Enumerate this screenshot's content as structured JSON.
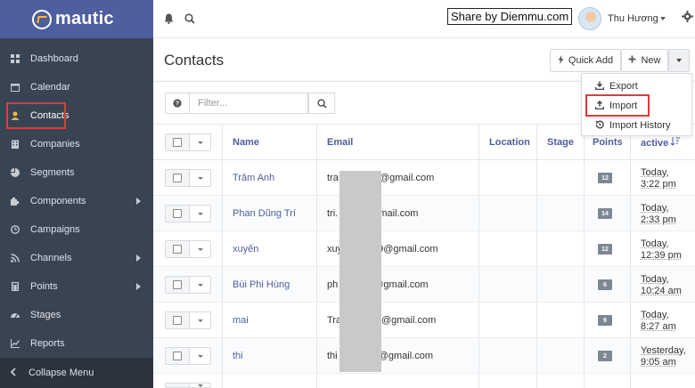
{
  "app": {
    "brand": "mautic"
  },
  "sidebar": {
    "items": [
      {
        "label": "Dashboard",
        "icon": "dashboard-icon"
      },
      {
        "label": "Calendar",
        "icon": "calendar-icon"
      },
      {
        "label": "Contacts",
        "icon": "user-icon"
      },
      {
        "label": "Companies",
        "icon": "building-icon"
      },
      {
        "label": "Segments",
        "icon": "pie-chart-icon"
      },
      {
        "label": "Components",
        "icon": "puzzle-icon"
      },
      {
        "label": "Campaigns",
        "icon": "clock-icon"
      },
      {
        "label": "Channels",
        "icon": "rss-icon"
      },
      {
        "label": "Points",
        "icon": "calculator-icon"
      },
      {
        "label": "Stages",
        "icon": "tachometer-icon"
      },
      {
        "label": "Reports",
        "icon": "line-chart-icon"
      }
    ],
    "collapse_label": "Collapse Menu"
  },
  "topbar": {
    "watermark": "Share by Diemmu.com",
    "user_name": "Thu Hương"
  },
  "page": {
    "title": "Contacts",
    "quick_add": "Quick Add",
    "new": "New"
  },
  "dropdown": {
    "export": "Export",
    "import": "Import",
    "import_history": "Import History"
  },
  "filter": {
    "placeholder": "Filter..."
  },
  "table": {
    "headers": {
      "name": "Name",
      "email": "Email",
      "location": "Location",
      "stage": "Stage",
      "points": "Points",
      "last_active": "active"
    },
    "rows": [
      {
        "name": "Trâm Anh",
        "email_start": "tra",
        "email_end": "4@gmail.com",
        "points": "12",
        "last_active_1": "Today,",
        "last_active_2": "3:22 pm"
      },
      {
        "name": "Phan Dũng Trí",
        "email_start": "tri.",
        "email_end": "gmail.com",
        "points": "14",
        "last_active_1": "Today,",
        "last_active_2": "2:33 pm"
      },
      {
        "name": "xuyến",
        "email_start": "xuy",
        "email_end": "9@gmail.com",
        "points": "12",
        "last_active_1": "Today,",
        "last_active_2": "12:39 pm"
      },
      {
        "name": "Bùi Phi Hùng",
        "email_start": "ph",
        "email_end": "@gmail.com",
        "points": "6",
        "last_active_1": "Today,",
        "last_active_2": "10:24 am"
      },
      {
        "name": "mai",
        "email_start": "Tra",
        "email_end": "ll@gmail.com",
        "points": "9",
        "last_active_1": "Today,",
        "last_active_2": "8:27 am"
      },
      {
        "name": "thi",
        "email_start": "thi",
        "email_end": "1@gmail.com",
        "points": "2",
        "last_active_1": "Yesterday,",
        "last_active_2": "9:05 am"
      }
    ]
  },
  "colors": {
    "sidebar_bg": "#394453",
    "brand_bar": "#4e5e9e",
    "accent_link": "#4e5e9e",
    "highlight_box": "#e03a3a"
  }
}
